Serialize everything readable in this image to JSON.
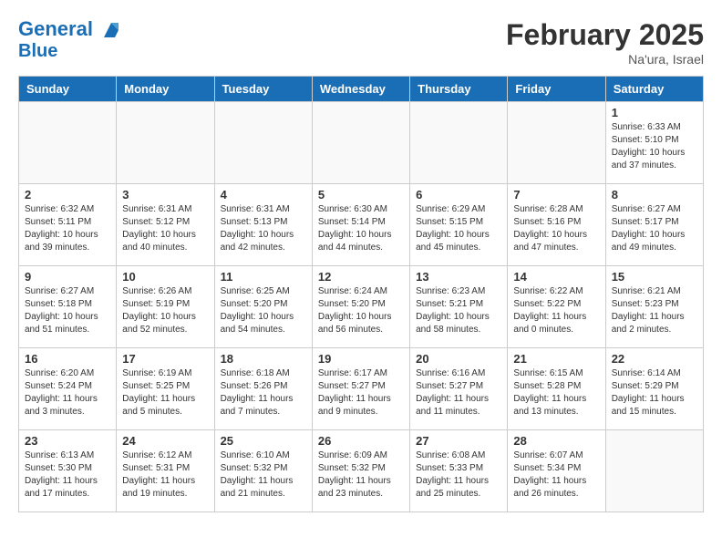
{
  "header": {
    "logo_line1": "General",
    "logo_line2": "Blue",
    "title": "February 2025",
    "subtitle": "Na'ura, Israel"
  },
  "weekdays": [
    "Sunday",
    "Monday",
    "Tuesday",
    "Wednesday",
    "Thursday",
    "Friday",
    "Saturday"
  ],
  "weeks": [
    [
      {
        "day": "",
        "info": ""
      },
      {
        "day": "",
        "info": ""
      },
      {
        "day": "",
        "info": ""
      },
      {
        "day": "",
        "info": ""
      },
      {
        "day": "",
        "info": ""
      },
      {
        "day": "",
        "info": ""
      },
      {
        "day": "1",
        "info": "Sunrise: 6:33 AM\nSunset: 5:10 PM\nDaylight: 10 hours and 37 minutes."
      }
    ],
    [
      {
        "day": "2",
        "info": "Sunrise: 6:32 AM\nSunset: 5:11 PM\nDaylight: 10 hours and 39 minutes."
      },
      {
        "day": "3",
        "info": "Sunrise: 6:31 AM\nSunset: 5:12 PM\nDaylight: 10 hours and 40 minutes."
      },
      {
        "day": "4",
        "info": "Sunrise: 6:31 AM\nSunset: 5:13 PM\nDaylight: 10 hours and 42 minutes."
      },
      {
        "day": "5",
        "info": "Sunrise: 6:30 AM\nSunset: 5:14 PM\nDaylight: 10 hours and 44 minutes."
      },
      {
        "day": "6",
        "info": "Sunrise: 6:29 AM\nSunset: 5:15 PM\nDaylight: 10 hours and 45 minutes."
      },
      {
        "day": "7",
        "info": "Sunrise: 6:28 AM\nSunset: 5:16 PM\nDaylight: 10 hours and 47 minutes."
      },
      {
        "day": "8",
        "info": "Sunrise: 6:27 AM\nSunset: 5:17 PM\nDaylight: 10 hours and 49 minutes."
      }
    ],
    [
      {
        "day": "9",
        "info": "Sunrise: 6:27 AM\nSunset: 5:18 PM\nDaylight: 10 hours and 51 minutes."
      },
      {
        "day": "10",
        "info": "Sunrise: 6:26 AM\nSunset: 5:19 PM\nDaylight: 10 hours and 52 minutes."
      },
      {
        "day": "11",
        "info": "Sunrise: 6:25 AM\nSunset: 5:20 PM\nDaylight: 10 hours and 54 minutes."
      },
      {
        "day": "12",
        "info": "Sunrise: 6:24 AM\nSunset: 5:20 PM\nDaylight: 10 hours and 56 minutes."
      },
      {
        "day": "13",
        "info": "Sunrise: 6:23 AM\nSunset: 5:21 PM\nDaylight: 10 hours and 58 minutes."
      },
      {
        "day": "14",
        "info": "Sunrise: 6:22 AM\nSunset: 5:22 PM\nDaylight: 11 hours and 0 minutes."
      },
      {
        "day": "15",
        "info": "Sunrise: 6:21 AM\nSunset: 5:23 PM\nDaylight: 11 hours and 2 minutes."
      }
    ],
    [
      {
        "day": "16",
        "info": "Sunrise: 6:20 AM\nSunset: 5:24 PM\nDaylight: 11 hours and 3 minutes."
      },
      {
        "day": "17",
        "info": "Sunrise: 6:19 AM\nSunset: 5:25 PM\nDaylight: 11 hours and 5 minutes."
      },
      {
        "day": "18",
        "info": "Sunrise: 6:18 AM\nSunset: 5:26 PM\nDaylight: 11 hours and 7 minutes."
      },
      {
        "day": "19",
        "info": "Sunrise: 6:17 AM\nSunset: 5:27 PM\nDaylight: 11 hours and 9 minutes."
      },
      {
        "day": "20",
        "info": "Sunrise: 6:16 AM\nSunset: 5:27 PM\nDaylight: 11 hours and 11 minutes."
      },
      {
        "day": "21",
        "info": "Sunrise: 6:15 AM\nSunset: 5:28 PM\nDaylight: 11 hours and 13 minutes."
      },
      {
        "day": "22",
        "info": "Sunrise: 6:14 AM\nSunset: 5:29 PM\nDaylight: 11 hours and 15 minutes."
      }
    ],
    [
      {
        "day": "23",
        "info": "Sunrise: 6:13 AM\nSunset: 5:30 PM\nDaylight: 11 hours and 17 minutes."
      },
      {
        "day": "24",
        "info": "Sunrise: 6:12 AM\nSunset: 5:31 PM\nDaylight: 11 hours and 19 minutes."
      },
      {
        "day": "25",
        "info": "Sunrise: 6:10 AM\nSunset: 5:32 PM\nDaylight: 11 hours and 21 minutes."
      },
      {
        "day": "26",
        "info": "Sunrise: 6:09 AM\nSunset: 5:32 PM\nDaylight: 11 hours and 23 minutes."
      },
      {
        "day": "27",
        "info": "Sunrise: 6:08 AM\nSunset: 5:33 PM\nDaylight: 11 hours and 25 minutes."
      },
      {
        "day": "28",
        "info": "Sunrise: 6:07 AM\nSunset: 5:34 PM\nDaylight: 11 hours and 26 minutes."
      },
      {
        "day": "",
        "info": ""
      }
    ]
  ]
}
